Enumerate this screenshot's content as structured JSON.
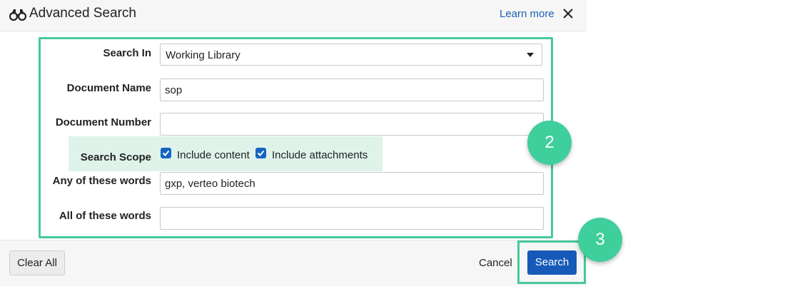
{
  "header": {
    "title": "Advanced Search",
    "learn_more": "Learn more",
    "icon": "binoculars-icon"
  },
  "form": {
    "search_in": {
      "label": "Search In",
      "value": "Working Library"
    },
    "document_name": {
      "label": "Document Name",
      "value": "sop"
    },
    "document_number": {
      "label": "Document Number",
      "value": ""
    },
    "search_scope": {
      "label": "Search Scope",
      "include_content": {
        "label": "Include content",
        "checked": true
      },
      "include_attachments": {
        "label": "Include attachments",
        "checked": true
      }
    },
    "any_words": {
      "label": "Any of these words",
      "value": "gxp, verteo biotech"
    },
    "all_words": {
      "label": "All of these words",
      "value": ""
    }
  },
  "footer": {
    "clear_all": "Clear All",
    "cancel": "Cancel",
    "search": "Search"
  },
  "annotations": {
    "step_2": "2",
    "step_3": "3"
  },
  "colors": {
    "highlight": "#46c99a",
    "badge": "#3fcf9c",
    "primary_button": "#1759b8",
    "link": "#1a5fb4",
    "scope_band": "#dff3ea"
  }
}
